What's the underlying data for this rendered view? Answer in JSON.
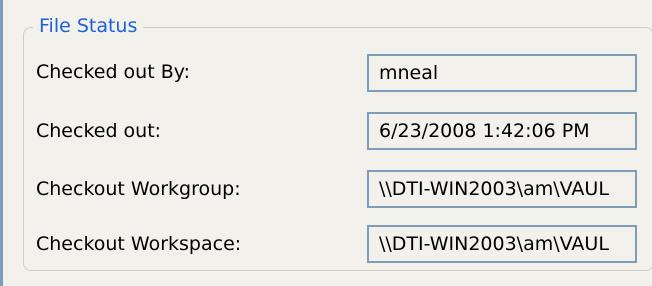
{
  "group": {
    "legend": "File Status"
  },
  "rows": [
    {
      "label": "Checked out By:",
      "value": "mneal"
    },
    {
      "label": "Checked out:",
      "value": "6/23/2008 1:42:06 PM"
    },
    {
      "label": "Checkout Workgroup:",
      "value": "\\\\DTI-WIN2003\\am\\VAUL"
    },
    {
      "label": "Checkout Workspace:",
      "value": "\\\\DTI-WIN2003\\am\\VAUL"
    }
  ]
}
